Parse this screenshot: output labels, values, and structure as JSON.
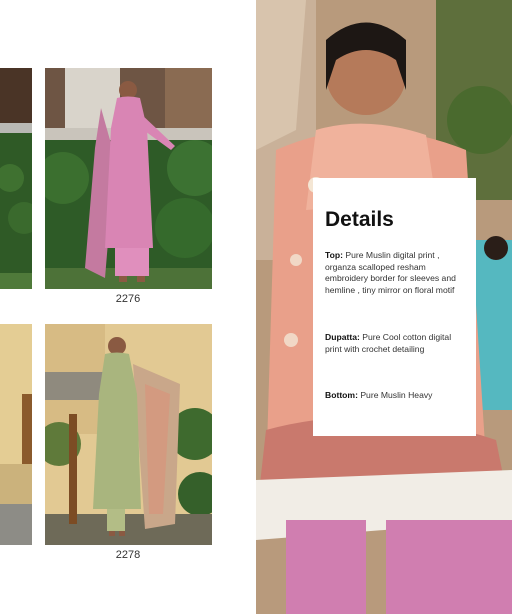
{
  "catalog": {
    "items": [
      {
        "code": "2276"
      },
      {
        "code": "2278"
      }
    ]
  },
  "details": {
    "title": "Details",
    "top_label": "Top:",
    "top_text": "Pure Muslin digital print , organza scalloped resham embroidery border for sleeves and hemline , tiny mirror on floral motif",
    "dupatta_label": "Dupatta:",
    "dupatta_text": "Pure Cool cotton digital print with crochet detailing",
    "bottom_label": "Bottom:",
    "bottom_text": "Pure Muslin Heavy"
  },
  "colors": {
    "dress_pink": "#d985b4",
    "dress_peach": "#e9a08a",
    "dress_green": "#a9b57e",
    "teal_outfit": "#55b8c0"
  }
}
